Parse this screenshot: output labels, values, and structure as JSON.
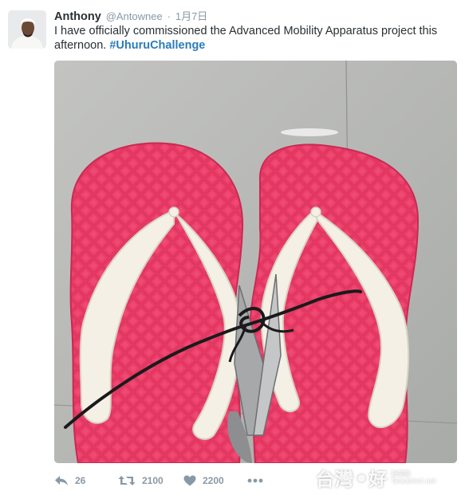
{
  "tweet": {
    "fullname": "Anthony",
    "username": "@Antownee",
    "separator": "·",
    "timestamp": "1月7日",
    "text": "I have officially commissioned the Advanced Mobility Apparatus project this afternoon. ",
    "hashtag": "#UhuruChallenge",
    "media_alt": "Pink flip-flops tied together with black string and a pair of scissors"
  },
  "actions": {
    "reply_icon": "reply-icon",
    "reply_count": "26",
    "retweet_icon": "retweet-icon",
    "retweet_count": "2100",
    "like_icon": "heart-icon",
    "like_count": "2200",
    "more_icon": "more-dots-icon"
  },
  "watermark": {
    "text_left": "台灣",
    "dot": "●",
    "text_right": "好",
    "small_line_1": "新聞報",
    "small_line_2": "Taiwanhot.net"
  },
  "colors": {
    "name": "#292f33",
    "meta": "#8899a6",
    "hashtag": "#2b7bb9",
    "sandal_pink": "#ec3f6a",
    "strap_white": "#f4f0e6"
  }
}
